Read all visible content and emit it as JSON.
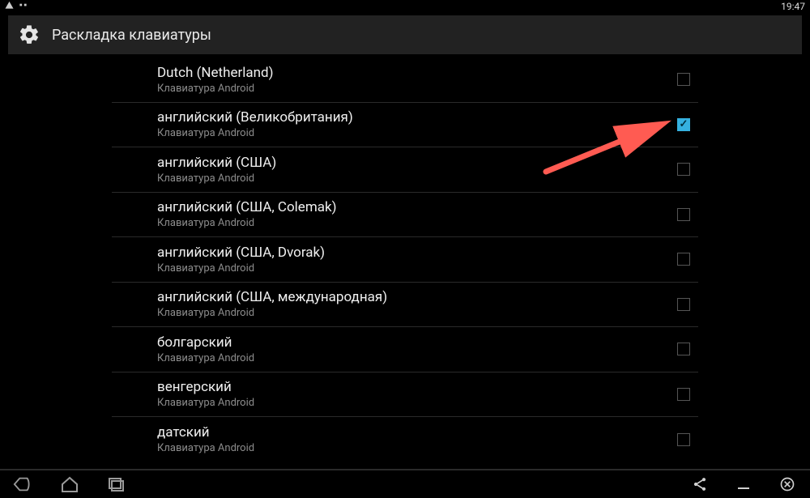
{
  "statusbar": {
    "warning_icon": "⚠",
    "time": "19:47"
  },
  "header": {
    "title": "Раскладка клавиатуры",
    "icon": "gear-icon"
  },
  "list": {
    "subtitle": "Клавиатура Android",
    "items": [
      {
        "title": "Dutch (Netherland)",
        "checked": false
      },
      {
        "title": "английский (Великобритания)",
        "checked": true
      },
      {
        "title": "английский (США)",
        "checked": false
      },
      {
        "title": "английский (США, Colemak)",
        "checked": false
      },
      {
        "title": "английский (США, Dvorak)",
        "checked": false
      },
      {
        "title": "английский (США, международная)",
        "checked": false
      },
      {
        "title": "болгарский",
        "checked": false
      },
      {
        "title": "венгерский",
        "checked": false
      },
      {
        "title": "датский",
        "checked": false
      }
    ]
  },
  "annotation": {
    "arrow_color": "#ff5b52"
  },
  "navbar": {
    "back": "back-icon",
    "home": "home-icon",
    "recent": "recent-icon",
    "share": "share-icon",
    "minimize": "minimize-icon",
    "close": "close-icon"
  }
}
